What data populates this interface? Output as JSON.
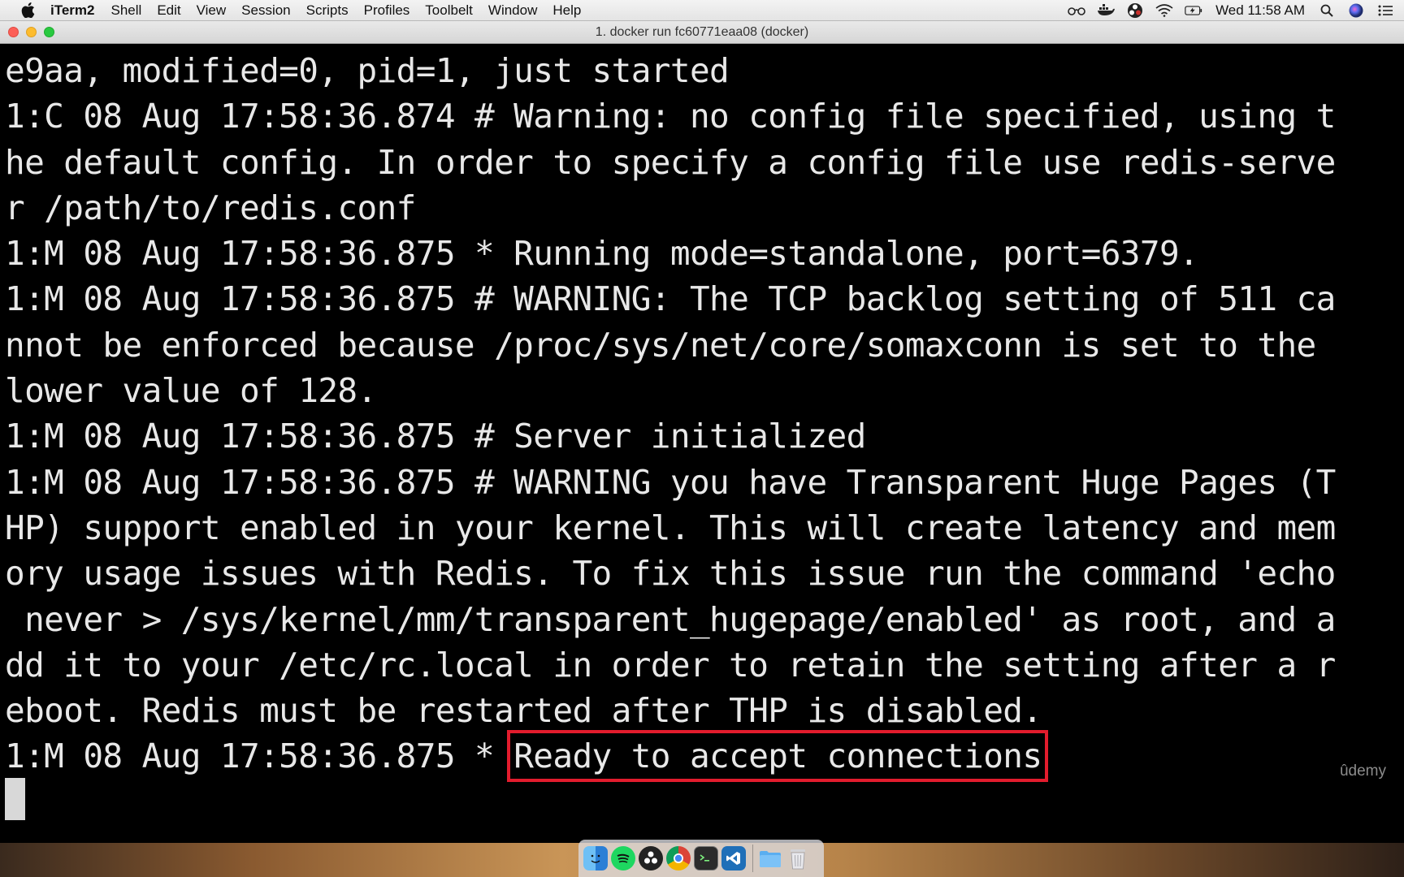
{
  "menubar": {
    "app_name": "iTerm2",
    "menus": [
      "Shell",
      "Edit",
      "View",
      "Session",
      "Scripts",
      "Profiles",
      "Toolbelt",
      "Window",
      "Help"
    ],
    "clock": "Wed 11:58 AM"
  },
  "window": {
    "title": "1. docker run fc60771eaa08 (docker)"
  },
  "terminal": {
    "lines": [
      "e9aa, modified=0, pid=1, just started",
      "1:C 08 Aug 17:58:36.874 # Warning: no config file specified, using t",
      "he default config. In order to specify a config file use redis-serve",
      "r /path/to/redis.conf",
      "1:M 08 Aug 17:58:36.875 * Running mode=standalone, port=6379.",
      "1:M 08 Aug 17:58:36.875 # WARNING: The TCP backlog setting of 511 ca",
      "nnot be enforced because /proc/sys/net/core/somaxconn is set to the",
      "lower value of 128.",
      "1:M 08 Aug 17:58:36.875 # Server initialized",
      "1:M 08 Aug 17:58:36.875 # WARNING you have Transparent Huge Pages (T",
      "HP) support enabled in your kernel. This will create latency and mem",
      "ory usage issues with Redis. To fix this issue run the command 'echo",
      " never > /sys/kernel/mm/transparent_hugepage/enabled' as root, and a",
      "dd it to your /etc/rc.local in order to retain the setting after a r",
      "eboot. Redis must be restarted after THP is disabled."
    ],
    "last_line_prefix": "1:M 08 Aug 17:58:36.875 * ",
    "last_line_highlight": "Ready to accept connections",
    "highlight_color": "#e21c2d"
  },
  "watermark": "ûdemy",
  "dock": {
    "icons": [
      "finder-icon",
      "spotify-icon",
      "obs-icon",
      "chrome-icon",
      "terminal-icon",
      "vscode-icon",
      "folder-icon",
      "trash-icon"
    ]
  }
}
